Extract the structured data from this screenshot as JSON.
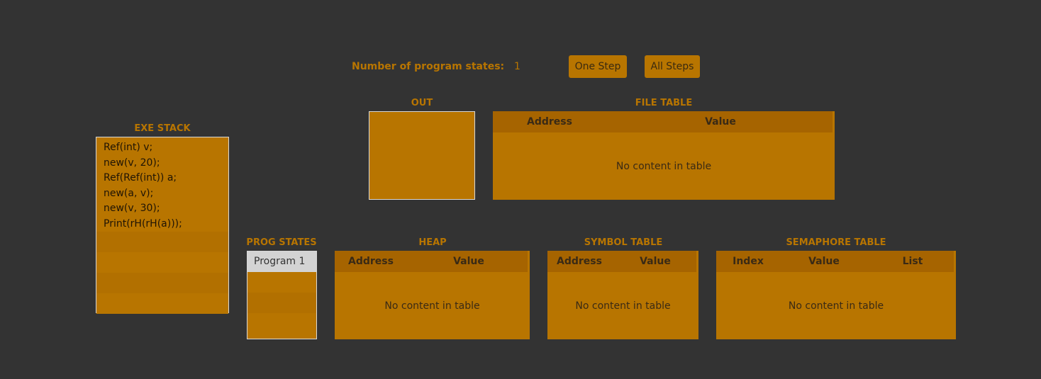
{
  "top": {
    "states_label": "Number of program states:",
    "states_count": "1",
    "one_step": "One Step",
    "all_steps": "All Steps"
  },
  "out": {
    "title": "OUT"
  },
  "file_table": {
    "title": "FILE TABLE",
    "columns": [
      "Address",
      "Value"
    ],
    "empty": "No content in table"
  },
  "exe_stack": {
    "title": "EXE STACK",
    "items": [
      "Ref(int) v;",
      "new(v, 20);",
      "Ref(Ref(int)) a;",
      "new(a, v);",
      "new(v, 30);",
      "Print(rH(rH(a)));"
    ]
  },
  "prog_states": {
    "title": "PROG STATES",
    "items": [
      "Program 1"
    ],
    "selected": "Program 1"
  },
  "heap": {
    "title": "HEAP",
    "columns": [
      "Address",
      "Value"
    ],
    "empty": "No content in table"
  },
  "symbol_table": {
    "title": "SYMBOL TABLE",
    "columns": [
      "Address",
      "Value"
    ],
    "empty": "No content in table"
  },
  "semaphore_table": {
    "title": "SEMAPHORE TABLE",
    "columns": [
      "Index",
      "Value",
      "List"
    ],
    "empty": "No content in table"
  },
  "colors": {
    "background": "#333333",
    "accent": "#b87500",
    "header": "#a66400"
  }
}
